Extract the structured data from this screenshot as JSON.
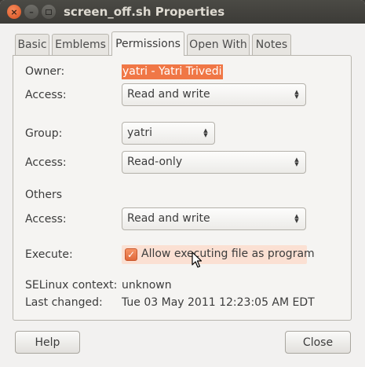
{
  "window": {
    "title": "screen_off.sh Properties",
    "controls": {
      "close": "×",
      "minimize": "–"
    }
  },
  "tabs": [
    "Basic",
    "Emblems",
    "Permissions",
    "Open With",
    "Notes"
  ],
  "active_tab": "Permissions",
  "permissions": {
    "owner_label": "Owner:",
    "owner_value": "yatri - Yatri Trivedi",
    "owner_access_label": "Access:",
    "owner_access_value": "Read and write",
    "group_label": "Group:",
    "group_value": "yatri",
    "group_access_label": "Access:",
    "group_access_value": "Read-only",
    "others_label": "Others",
    "others_access_label": "Access:",
    "others_access_value": "Read and write",
    "execute_label": "Execute:",
    "execute_checkbox_label": "Allow executing file as program",
    "execute_checked": true,
    "selinux_label": "SELinux context:",
    "selinux_value": "unknown",
    "last_changed_label": "Last changed:",
    "last_changed_value": "Tue 03 May 2011 12:23:05 AM EDT"
  },
  "buttons": {
    "help": "Help",
    "close": "Close"
  },
  "colors": {
    "accent": "#f07746",
    "titlebar": "#3c3b37",
    "background": "#f2f1f0"
  }
}
